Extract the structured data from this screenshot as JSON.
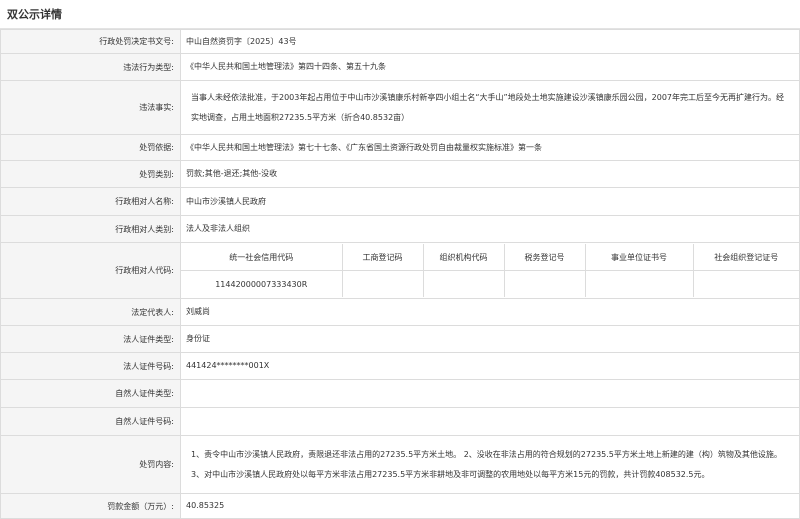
{
  "title": "双公示详情",
  "fields": {
    "decision_no": {
      "label": "行政处罚决定书文号:",
      "value": "中山自然资罚字〔2025〕43号"
    },
    "violation_type": {
      "label": "违法行为类型:",
      "value": "《中华人民共和国土地管理法》第四十四条、第五十九条"
    },
    "violation_fact": {
      "label": "违法事实:",
      "value": "当事人未经依法批准，于2003年起占用位于中山市沙溪镇康乐村新亭四小组土名“大手山”地段处土地实施建设沙溪镇康乐园公园，2007年完工后至今无再扩建行为。经实地调查，占用土地面积27235.5平方米（折合40.8532亩）"
    },
    "basis": {
      "label": "处罚依据:",
      "value": "《中华人民共和国土地管理法》第七十七条、《广东省国土资源行政处罚自由裁量权实施标准》第一条"
    },
    "category": {
      "label": "处罚类别:",
      "value": "罚款;其他-退还;其他-没收"
    },
    "party_name": {
      "label": "行政相对人名称:",
      "value": "中山市沙溪镇人民政府"
    },
    "party_type": {
      "label": "行政相对人类别:",
      "value": "法人及非法人组织"
    },
    "party_code": {
      "label": "行政相对人代码:",
      "headers": [
        "统一社会信用代码",
        "工商登记码",
        "组织机构代码",
        "税务登记号",
        "事业单位证书号",
        "社会组织登记证号"
      ],
      "values": [
        "11442000007333430R",
        "",
        "",
        "",
        "",
        ""
      ]
    },
    "legal_rep": {
      "label": "法定代表人:",
      "value": "刘威尚"
    },
    "legal_id_type": {
      "label": "法人证件类型:",
      "value": "身份证"
    },
    "legal_id_no": {
      "label": "法人证件号码:",
      "value": "441424********001X"
    },
    "person_id_type": {
      "label": "自然人证件类型:",
      "value": ""
    },
    "person_id_no": {
      "label": "自然人证件号码:",
      "value": ""
    },
    "content": {
      "label": "处罚内容:",
      "value": "1、责令中山市沙溪镇人民政府，责限退还非法占用的27235.5平方米土地。 2、没收在非法占用的符合规划的27235.5平方米土地上新建的建（构）筑物及其他设施。 3、对中山市沙溪镇人民政府处以每平方米非法占用27235.5平方米非耕地及非可调整的农用地处以每平方米15元的罚款，共计罚款408532.5元。"
    },
    "amount": {
      "label": "罚款金额（万元）:",
      "value": "40.85325"
    }
  }
}
